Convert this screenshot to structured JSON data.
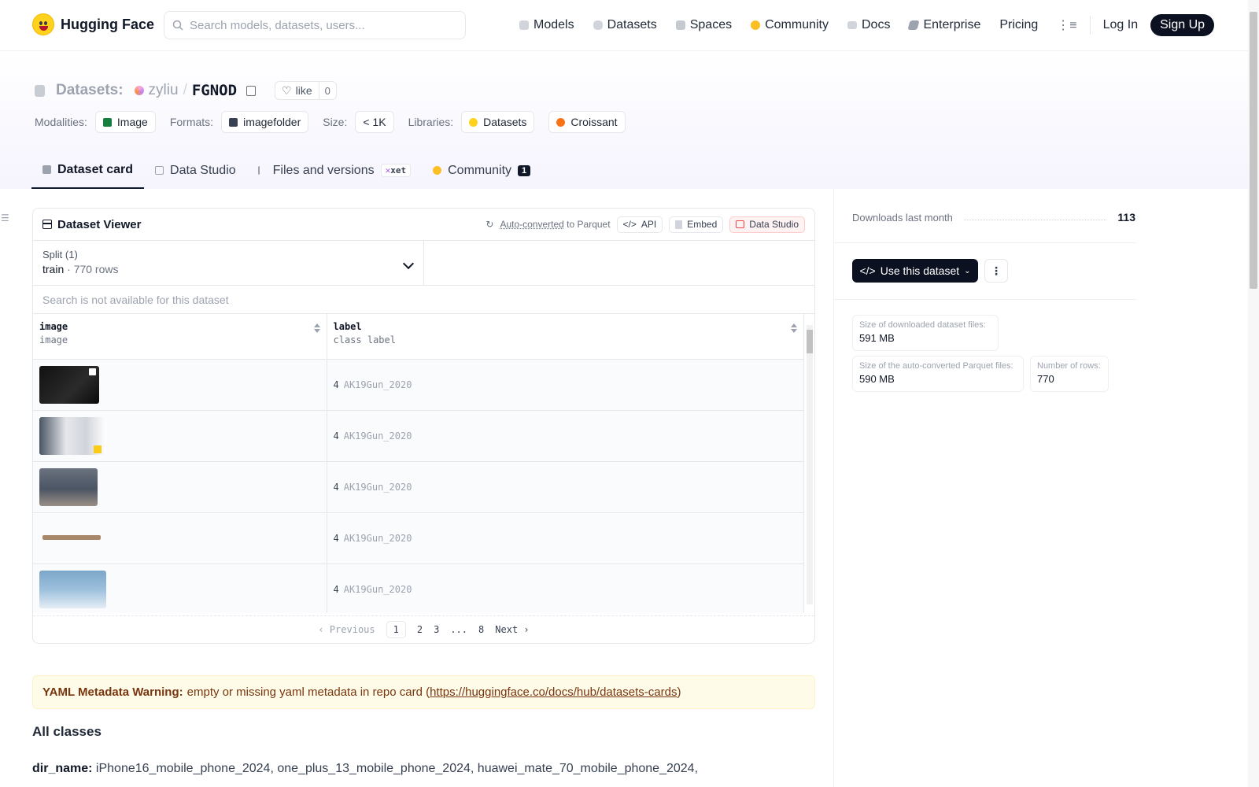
{
  "header": {
    "brand": "Hugging Face",
    "search_placeholder": "Search models, datasets, users...",
    "nav": [
      {
        "label": "Models",
        "icon": "cube-icon"
      },
      {
        "label": "Datasets",
        "icon": "database-icon"
      },
      {
        "label": "Spaces",
        "icon": "spaces-icon"
      },
      {
        "label": "Community",
        "icon": "community-icon"
      },
      {
        "label": "Docs",
        "icon": "book-icon"
      },
      {
        "label": "Enterprise",
        "icon": "enterprise-icon"
      },
      {
        "label": "Pricing",
        "icon": ""
      }
    ],
    "login": "Log In",
    "signup": "Sign Up"
  },
  "repo": {
    "type_label": "Datasets:",
    "owner": "zyliu",
    "separator": "/",
    "name": "FGNOD",
    "like_label": "like",
    "like_count": "0"
  },
  "meta": {
    "modalities_key": "Modalities:",
    "modalities": "Image",
    "formats_key": "Formats:",
    "formats": "imagefolder",
    "size_key": "Size:",
    "size": "< 1K",
    "libraries_key": "Libraries:",
    "libraries": [
      "Datasets",
      "Croissant"
    ]
  },
  "tabs": [
    {
      "label": "Dataset card",
      "active": true
    },
    {
      "label": "Data Studio"
    },
    {
      "label": "Files and versions",
      "badge": "xet"
    },
    {
      "label": "Community",
      "badge": "1"
    }
  ],
  "viewer": {
    "title": "Dataset Viewer",
    "auto_converted": "Auto-converted",
    "to_parquet": "to Parquet",
    "api": "API",
    "embed": "Embed",
    "data_studio": "Data Studio",
    "split_label": "Split (1)",
    "split_name": "train",
    "split_dot": "·",
    "split_rows": "770 rows",
    "search_na": "Search is not available for this dataset",
    "columns": [
      {
        "name": "image",
        "type": "image"
      },
      {
        "name": "label",
        "type": "class label"
      }
    ],
    "rows": [
      {
        "num": "4",
        "cls": "AK19Gun_2020"
      },
      {
        "num": "4",
        "cls": "AK19Gun_2020"
      },
      {
        "num": "4",
        "cls": "AK19Gun_2020"
      },
      {
        "num": "4",
        "cls": "AK19Gun_2020"
      },
      {
        "num": "4",
        "cls": "AK19Gun_2020"
      }
    ],
    "pager": {
      "previous": "Previous",
      "pages": [
        "1",
        "2",
        "3",
        "...",
        "8"
      ],
      "next": "Next"
    }
  },
  "warning": {
    "bold": "YAML Metadata Warning:",
    "text": "empty or missing yaml metadata in repo card (",
    "link": "https://huggingface.co/docs/hub/datasets-cards",
    "close": ")"
  },
  "content": {
    "heading": "All classes",
    "dir_key": "dir_name:",
    "dir_values": "iPhone16_mobile_phone_2024, one_plus_13_mobile_phone_2024, huawei_mate_70_mobile_phone_2024,"
  },
  "sidebar": {
    "downloads_label": "Downloads last month",
    "downloads_value": "113",
    "use_button": "Use this dataset",
    "stats": [
      {
        "label": "Size of downloaded dataset files:",
        "value": "591 MB"
      },
      {
        "label": "Size of the auto-converted Parquet files:",
        "value": "590 MB"
      },
      {
        "label": "Number of rows:",
        "value": "770"
      }
    ]
  },
  "colors": {
    "brand_yellow": "#ffd21e",
    "dark_button": "#0b1120",
    "warning_bg": "#fefce8"
  }
}
